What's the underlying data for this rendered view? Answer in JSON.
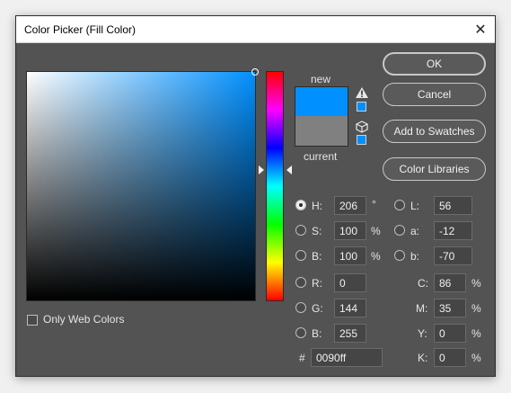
{
  "title": "Color Picker (Fill Color)",
  "labels": {
    "new": "new",
    "current": "current"
  },
  "colors": {
    "new": "#0090ff",
    "current": "#808080"
  },
  "buttons": {
    "ok": "OK",
    "cancel": "Cancel",
    "add_to_swatches": "Add to Swatches",
    "color_libraries": "Color Libraries"
  },
  "only_web_colors": {
    "label": "Only Web Colors",
    "checked": false
  },
  "hsb": {
    "h": {
      "label": "H:",
      "value": "206",
      "unit": "°",
      "selected": true
    },
    "s": {
      "label": "S:",
      "value": "100",
      "unit": "%"
    },
    "b": {
      "label": "B:",
      "value": "100",
      "unit": "%"
    }
  },
  "rgb": {
    "r": {
      "label": "R:",
      "value": "0"
    },
    "g": {
      "label": "G:",
      "value": "144"
    },
    "b": {
      "label": "B:",
      "value": "255"
    }
  },
  "lab": {
    "l": {
      "label": "L:",
      "value": "56"
    },
    "a": {
      "label": "a:",
      "value": "-12"
    },
    "b": {
      "label": "b:",
      "value": "-70"
    }
  },
  "cmyk": {
    "c": {
      "label": "C:",
      "value": "86",
      "unit": "%"
    },
    "m": {
      "label": "M:",
      "value": "35",
      "unit": "%"
    },
    "y": {
      "label": "Y:",
      "value": "0",
      "unit": "%"
    },
    "k": {
      "label": "K:",
      "value": "0",
      "unit": "%"
    }
  },
  "hex": {
    "label": "#",
    "value": "0090ff"
  },
  "icons": {
    "close": "close-icon",
    "warning": "out-of-gamut-warning-icon",
    "web_safe": "web-safe-cube-icon"
  }
}
